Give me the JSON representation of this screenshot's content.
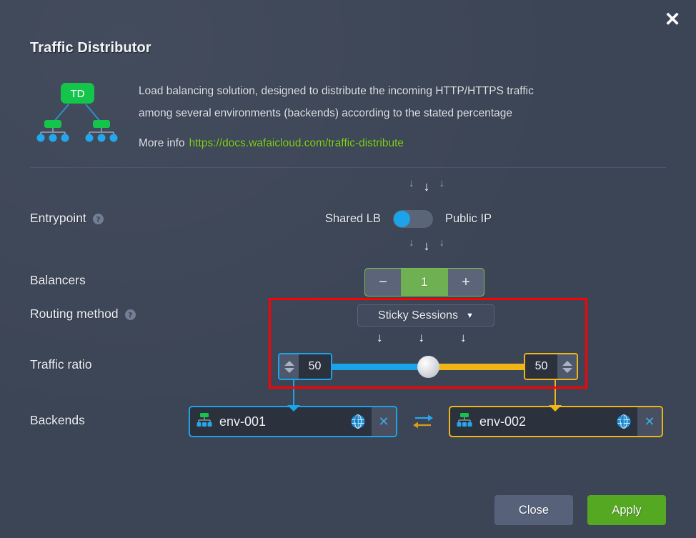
{
  "dialog": {
    "title": "Traffic Distributor",
    "close_icon": "close-icon"
  },
  "info": {
    "badge_label": "TD",
    "description_line1": "Load balancing solution, designed to distribute the incoming HTTP/HTTPS traffic",
    "description_line2": "among several environments (backends) according to the stated percentage",
    "more_info_label": "More info",
    "more_info_url": "https://docs.wafaicloud.com/traffic-distribute",
    "link_color": "#7ed321"
  },
  "entrypoint": {
    "label": "Entrypoint",
    "help_icon": "help-icon",
    "option_left": "Shared LB",
    "option_right": "Public IP",
    "selected": "Shared LB",
    "toggle_color": "#1ba4ea"
  },
  "balancers": {
    "label": "Balancers",
    "value": "1",
    "decrement_label": "−",
    "increment_label": "+",
    "accent_color": "#6fb053"
  },
  "routing": {
    "label": "Routing method",
    "help_icon": "help-icon",
    "selected": "Sticky Sessions",
    "caret_icon": "chevron-down-icon"
  },
  "traffic_ratio": {
    "label": "Traffic ratio",
    "left_value": "50",
    "right_value": "50",
    "left_color": "#1ba4ea",
    "right_color": "#f0b618"
  },
  "backends": {
    "label": "Backends",
    "swap_icon": "swap-arrows-icon",
    "items": [
      {
        "name": "env-001",
        "env_icon": "environment-icon",
        "globe_icon": "globe-icon",
        "close_icon": "close-icon",
        "accent": "#1ba4ea"
      },
      {
        "name": "env-002",
        "env_icon": "environment-icon",
        "globe_icon": "globe-icon",
        "close_icon": "close-icon",
        "accent": "#f0b618"
      }
    ]
  },
  "arrows": {
    "down": "↓"
  },
  "footer": {
    "close_label": "Close",
    "apply_label": "Apply",
    "apply_color": "#55a822"
  },
  "highlight": {
    "color": "#ff0000"
  }
}
